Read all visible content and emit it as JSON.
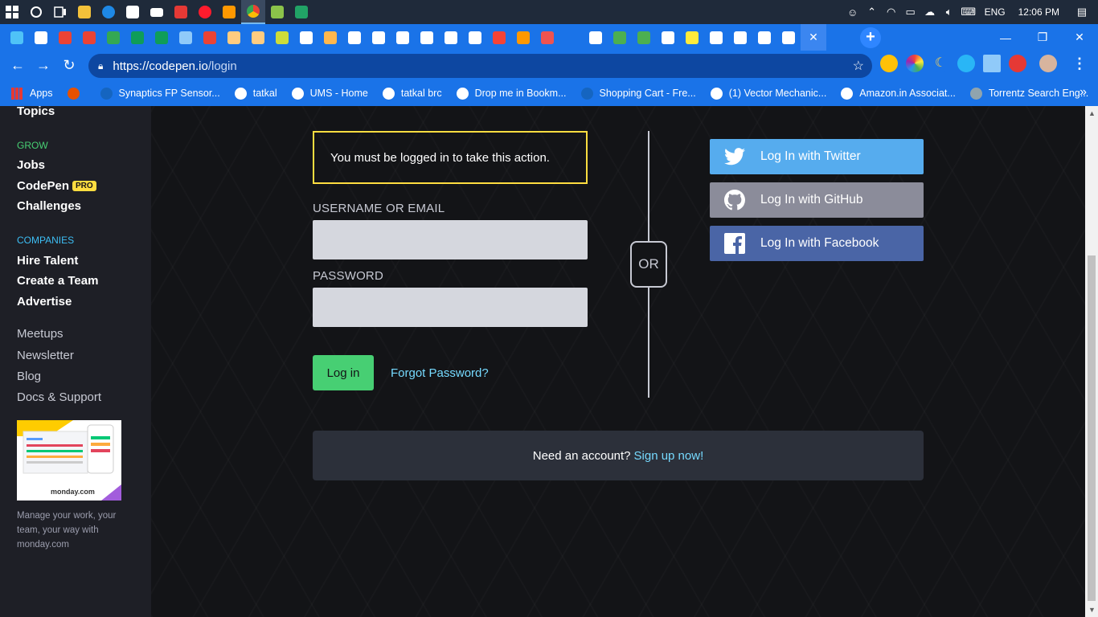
{
  "taskbar": {
    "apps": [
      {
        "name": "start-icon",
        "color": "#ffffff"
      },
      {
        "name": "search-circle-icon",
        "color": "#ffffff"
      },
      {
        "name": "task-view-icon",
        "color": "#ffffff"
      },
      {
        "name": "file-explorer-icon",
        "color": "#f3c13a"
      },
      {
        "name": "edge-icon",
        "color": "#1e88e5"
      },
      {
        "name": "store-icon",
        "color": "#ffffff"
      },
      {
        "name": "mail-icon",
        "color": "#ffffff"
      },
      {
        "name": "psiphon-icon",
        "color": "#e53935"
      },
      {
        "name": "opera-icon",
        "color": "#ff1b2d"
      },
      {
        "name": "sublime-icon",
        "color": "#ff9800"
      },
      {
        "name": "chrome-icon",
        "color": "#4caf50"
      },
      {
        "name": "stack-app-icon",
        "color": "#8bc34a"
      },
      {
        "name": "excel-icon",
        "color": "#21a366"
      }
    ],
    "language": "ENG",
    "time": "12:06 PM"
  },
  "browser": {
    "tab_count_favicons": [
      "#4fc3f7",
      "#ffffff",
      "#ea4335",
      "#ea4335",
      "#34a853",
      "#0f9d58",
      "#0f9d58",
      "#90caf9",
      "#ea4335",
      "#ffcc80",
      "#ffcc80",
      "#cddc39",
      "#ffffff",
      "#ffb74d",
      "#ffffff",
      "#ffffff",
      "#ffffff",
      "#ffffff",
      "#ffffff",
      "#ffffff",
      "#f44336",
      "#ff9800",
      "#ef5350",
      "#1a73e8",
      "#ffffff",
      "#4caf50",
      "#4caf50",
      "#ffffff",
      "#ffeb3b",
      "#ffffff",
      "#ffffff",
      "#ffffff",
      "#ffffff",
      "#1a73e8"
    ],
    "url_host": "https://codepen.io",
    "url_path": "/login",
    "new_tab_label": "+",
    "bookmarks": [
      {
        "label": "Apps",
        "icon": "apps-grid-icon"
      },
      {
        "label": "",
        "icon": "basketball-icon"
      },
      {
        "label": "Synaptics FP Sensor...",
        "icon": "synaptics-icon"
      },
      {
        "label": "tatkal",
        "icon": "globe-icon"
      },
      {
        "label": "UMS - Home",
        "icon": "globe-icon"
      },
      {
        "label": "tatkal brc",
        "icon": "globe-icon"
      },
      {
        "label": "Drop me in Bookm...",
        "icon": "globe-icon"
      },
      {
        "label": "Shopping Cart - Fre...",
        "icon": "noun-icon"
      },
      {
        "label": "(1) Vector Mechanic...",
        "icon": "a-logo-icon"
      },
      {
        "label": "Amazon.in Associat...",
        "icon": "amazon-icon"
      },
      {
        "label": "Torrentz Search Eng...",
        "icon": "torrentz-icon"
      }
    ],
    "more_bookmarks": "»"
  },
  "sidebar": {
    "topics": "Topics",
    "grow_heading": "GROW",
    "jobs": "Jobs",
    "codepen": "CodePen",
    "pro_badge": "PRO",
    "challenges": "Challenges",
    "companies_heading": "COMPANIES",
    "hire_talent": "Hire Talent",
    "create_team": "Create a Team",
    "advertise": "Advertise",
    "meetups": "Meetups",
    "newsletter": "Newsletter",
    "blog": "Blog",
    "docs_support": "Docs & Support",
    "ad_text": "Manage your work, your team, your way with monday.com",
    "ad_brand": "monday.com"
  },
  "login": {
    "alert": "You must be logged in to take this action.",
    "username_label": "USERNAME OR EMAIL",
    "username_value": "",
    "password_label": "PASSWORD",
    "password_value": "",
    "login_button": "Log in",
    "forgot_link": "Forgot Password?",
    "or": "OR",
    "twitter": "Log In with Twitter",
    "github": "Log In with GitHub",
    "facebook": "Log In with Facebook",
    "need_account": "Need an account?",
    "signup_link": "Sign up now!"
  },
  "colors": {
    "accent_green": "#47cf73",
    "accent_yellow": "#ffdd40",
    "link_blue": "#76daff",
    "twitter": "#56acee",
    "github": "#8b8c9a",
    "facebook": "#4a65a6"
  }
}
